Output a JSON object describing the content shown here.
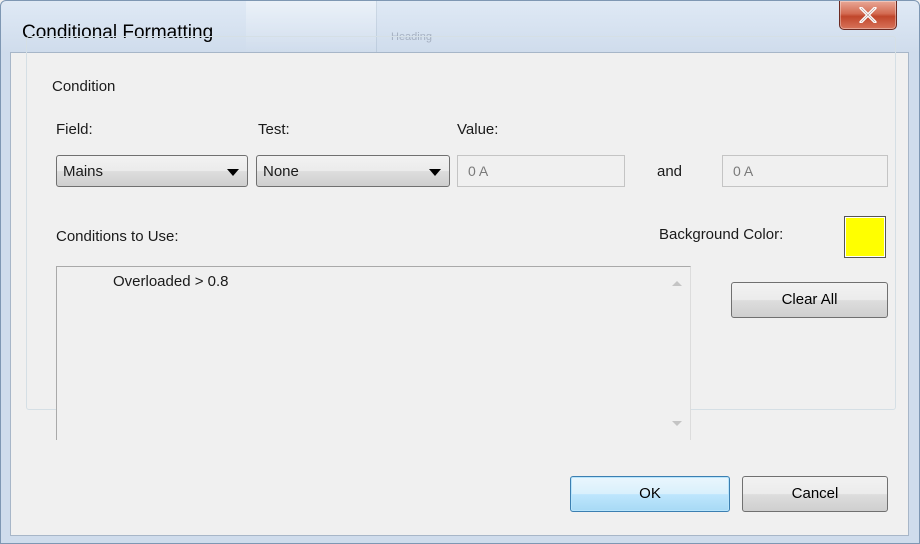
{
  "window": {
    "title": "Conditional Formatting",
    "background_ghost_text": "Heading"
  },
  "condition": {
    "group_label": "Condition",
    "field": {
      "label": "Field:",
      "selected": "Mains"
    },
    "test": {
      "label": "Test:",
      "selected": "None"
    },
    "value": {
      "label": "Value:",
      "value1": "0 A",
      "and_label": "and",
      "value2": "0 A"
    }
  },
  "conditions_to_use": {
    "label": "Conditions to Use:",
    "items": [
      "Overloaded > 0.8"
    ]
  },
  "background_color": {
    "label": "Background Color:",
    "color": "#ffff00"
  },
  "buttons": {
    "clear_all": "Clear All",
    "ok": "OK",
    "cancel": "Cancel"
  }
}
